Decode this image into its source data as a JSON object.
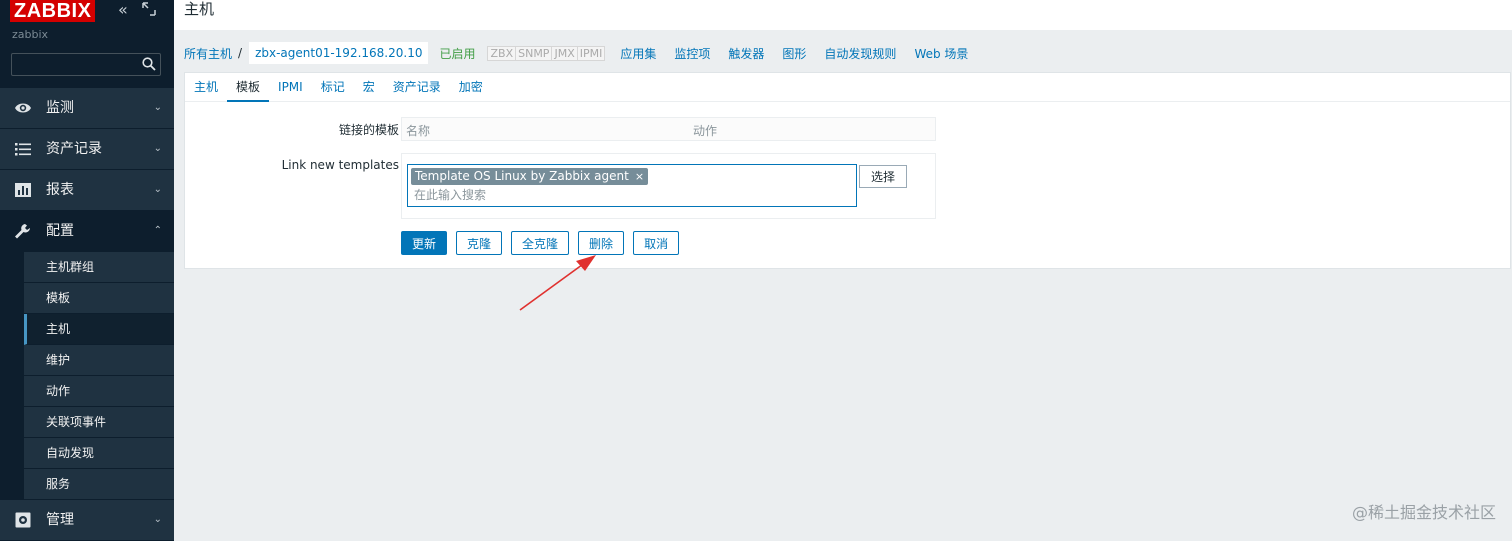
{
  "sidebar": {
    "logo": "ZABBIX",
    "server_name": "zabbix",
    "search_placeholder": "",
    "menu": [
      {
        "label": "监测",
        "icon": "eye-icon"
      },
      {
        "label": "资产记录",
        "icon": "list-icon"
      },
      {
        "label": "报表",
        "icon": "bar-chart-icon"
      },
      {
        "label": "配置",
        "icon": "wrench-icon"
      },
      {
        "label": "管理",
        "icon": "gear-icon"
      }
    ],
    "config_submenu": [
      "主机群组",
      "模板",
      "主机",
      "维护",
      "动作",
      "关联项事件",
      "自动发现",
      "服务"
    ]
  },
  "header": {
    "title": "主机"
  },
  "nav": {
    "all_hosts": "所有主机",
    "separator": "/",
    "current_host": "zbx-agent01-192.168.20.10",
    "status": "已启用",
    "availability": [
      "ZBX",
      "SNMP",
      "JMX",
      "IPMI"
    ],
    "links": [
      "应用集",
      "监控项",
      "触发器",
      "图形",
      "自动发现规则",
      "Web 场景"
    ]
  },
  "tabs": [
    "主机",
    "模板",
    "IPMI",
    "标记",
    "宏",
    "资产记录",
    "加密"
  ],
  "active_tab": "模板",
  "form": {
    "linked_label": "链接的模板",
    "col_name": "名称",
    "col_action": "动作",
    "link_new_label": "Link new templates",
    "selected_template": "Template OS Linux by Zabbix agent",
    "chip_remove": "×",
    "search_placeholder": "在此输入搜索",
    "select_button": "选择"
  },
  "buttons": {
    "update": "更新",
    "clone": "克隆",
    "full_clone": "全克隆",
    "delete": "删除",
    "cancel": "取消"
  },
  "colors": {
    "sidebar_bg": "#0d1e2d",
    "accent": "#0275b8",
    "logo_red": "#d40000",
    "enabled_green": "#429e47",
    "annotation_arrow": "#e0312f"
  },
  "watermark": "@稀土掘金技术社区"
}
